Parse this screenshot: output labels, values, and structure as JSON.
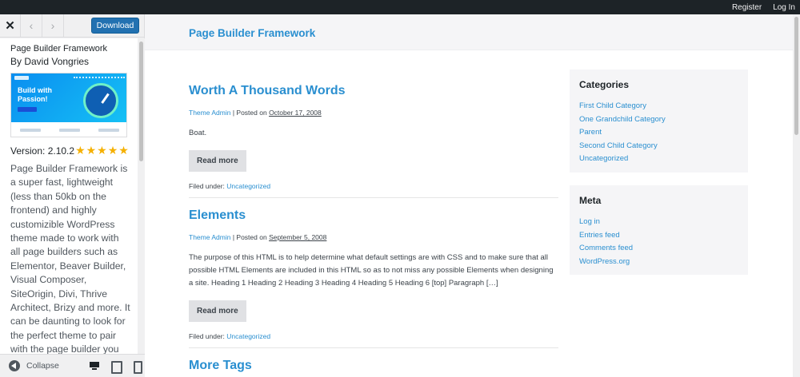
{
  "adminbar": {
    "register": "Register",
    "login": "Log In"
  },
  "sidebar": {
    "close": "✕",
    "prev": "‹",
    "next": "›",
    "download": "Download",
    "theme_name": "Page Builder Framework",
    "author": "By David Vongries",
    "screenshot": {
      "hero_line1": "Build with",
      "hero_line2": "Passion!"
    },
    "version": "Version: 2.10.2",
    "rating_stars": 5,
    "stars": "★★★★★",
    "description": "Page Builder Framework is a super fast, lightweight (less than 50kb on the frontend) and highly customizible WordPress theme made to work with all page builders such as Elementor, Beaver Builder, Visual Composer, SiteOrigin, Divi, Thrive Architect, Brizy and more. It can be daunting to look for the perfect theme to pair with the page builder you",
    "collapse": "Collapse"
  },
  "site": {
    "title": "Page Builder Framework",
    "posts": [
      {
        "title": "Worth A Thousand Words",
        "author": "Theme Admin",
        "posted_on": "| Posted on",
        "date": "October 17, 2008",
        "excerpt": "Boat.",
        "read_more": "Read more",
        "filed_label": "Filed under:",
        "category": "Uncategorized"
      },
      {
        "title": "Elements",
        "author": "Theme Admin",
        "posted_on": "| Posted on",
        "date": "September 5, 2008",
        "excerpt": "The purpose of this HTML is to help determine what default settings are with CSS and to make sure that all possible HTML Elements are included in this HTML so as to not miss any possible Elements when designing a site. Heading 1 Heading 2 Heading 3 Heading 4 Heading 5 Heading 6 [top] Paragraph […]",
        "read_more": "Read more",
        "filed_label": "Filed under:",
        "category": "Uncategorized"
      },
      {
        "title": "More Tags"
      }
    ],
    "categories": {
      "title": "Categories",
      "items": [
        "First Child Category",
        "One Grandchild Category",
        "Parent",
        "Second Child Category",
        "Uncategorized"
      ]
    },
    "meta": {
      "title": "Meta",
      "items": [
        "Log in",
        "Entries feed",
        "Comments feed",
        "WordPress.org"
      ]
    }
  }
}
